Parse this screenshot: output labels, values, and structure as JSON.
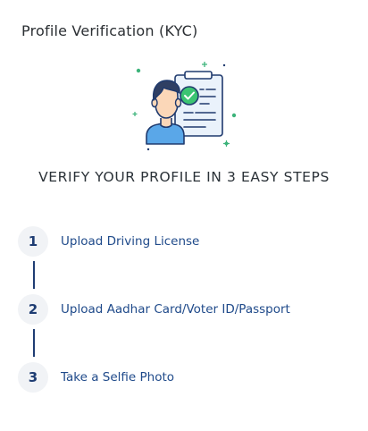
{
  "header": {
    "title": "Profile Verification (KYC)"
  },
  "illustration": {
    "icon": "verified-profile-illustration",
    "colors": {
      "outline": "#1f3a6e",
      "skin": "#fbd7b8",
      "hair": "#2f3f63",
      "shirt": "#5aa7e8",
      "document": "#eaf2fb",
      "check": "#3cc472",
      "sparkle": "#3cb37a"
    }
  },
  "main": {
    "headline": "VERIFY YOUR PROFILE IN 3 EASY STEPS",
    "steps": [
      {
        "number": "1",
        "label": "Upload Driving License"
      },
      {
        "number": "2",
        "label": "Upload Aadhar Card/Voter ID/Passport"
      },
      {
        "number": "3",
        "label": "Take a Selfie Photo"
      }
    ]
  },
  "colors": {
    "accent": "#1f4a8a",
    "step_circle_bg": "#f1f3f6",
    "connector": "#1f3d73"
  }
}
